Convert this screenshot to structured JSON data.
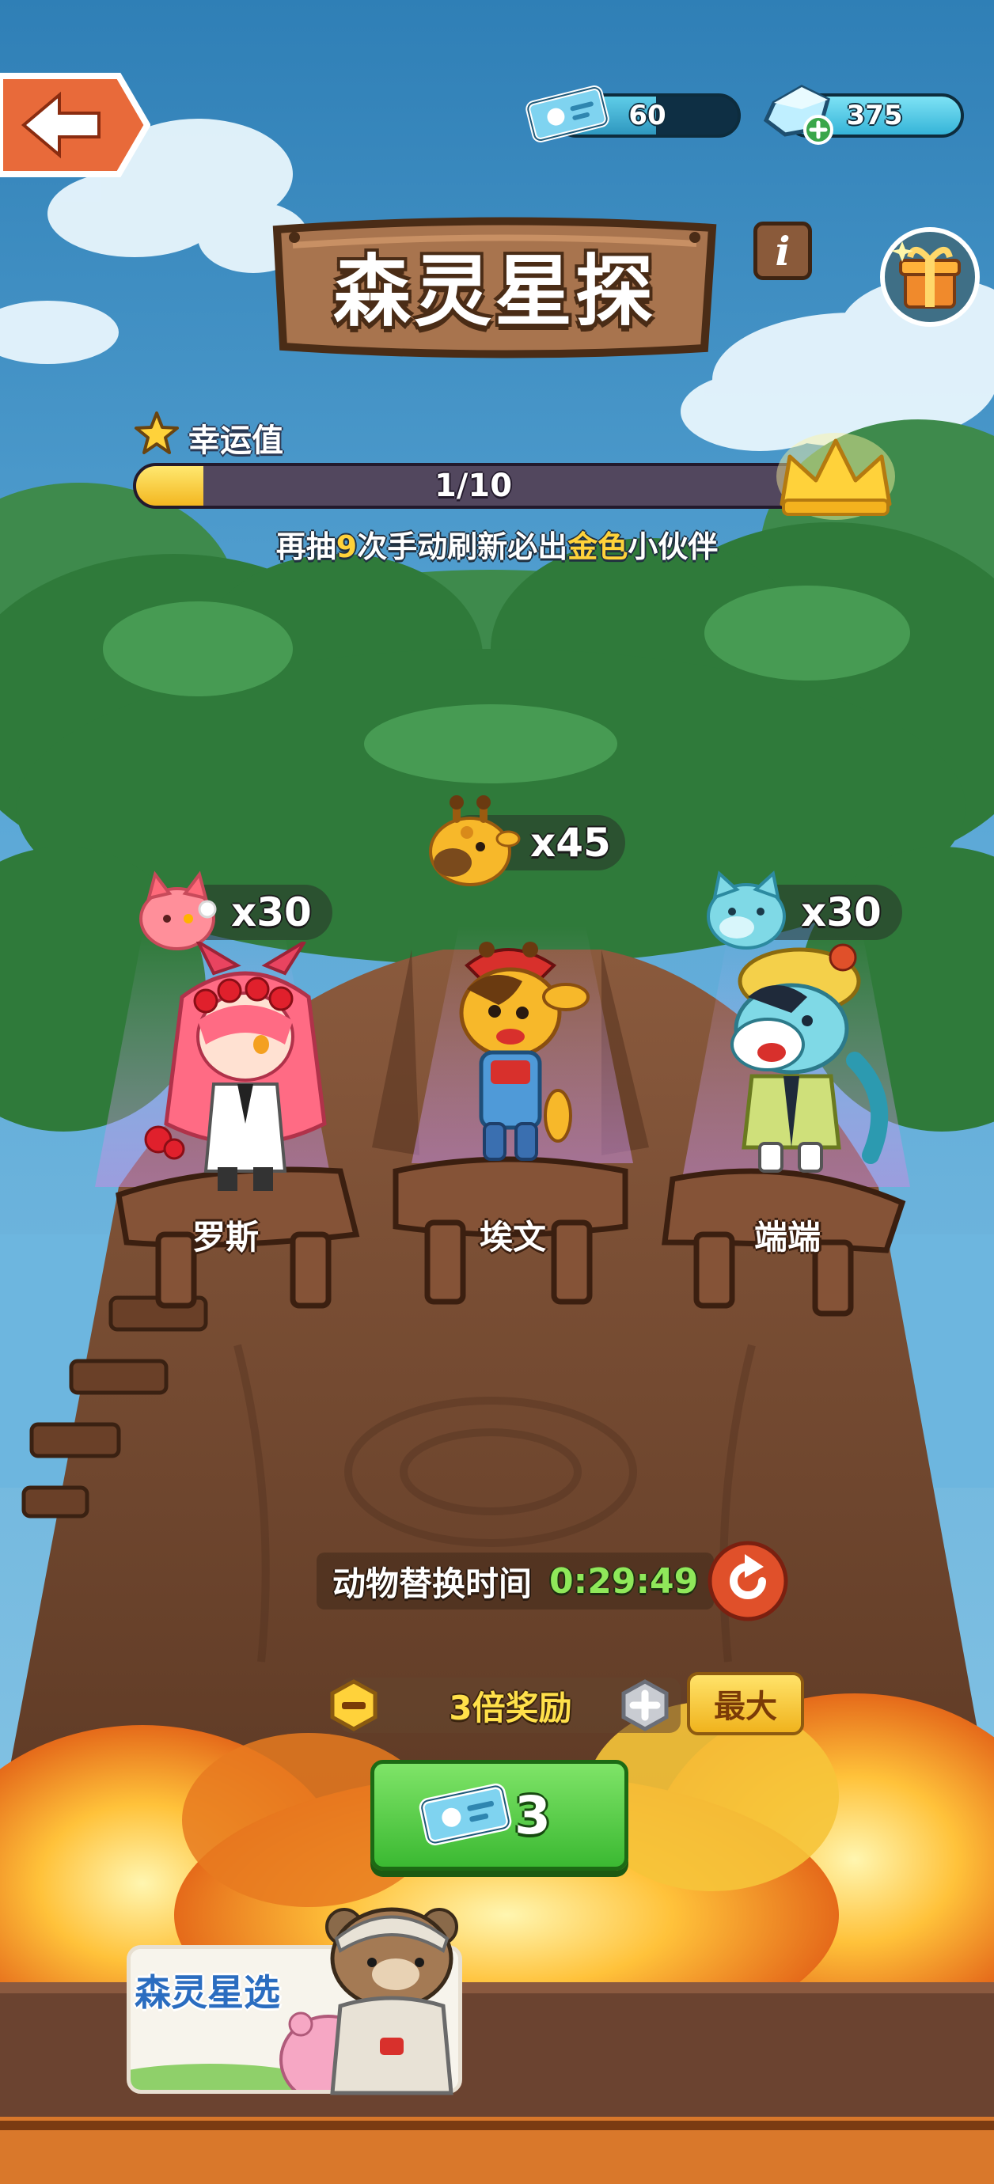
{
  "header": {
    "tickets": {
      "value": "60",
      "fill_fraction": 0.55
    },
    "gems": {
      "value": "375"
    }
  },
  "title": "森灵星探",
  "info_icon_glyph": "i",
  "luck": {
    "label": "幸运值",
    "current": 1,
    "max": 10,
    "count_text": "1/10",
    "hint_prefix": "再抽",
    "hint_number": "9",
    "hint_middle": "次手动刷新必出",
    "hint_highlight": "金色",
    "hint_suffix": "小伙伴"
  },
  "companions": [
    {
      "name": "罗斯",
      "reward": "x30",
      "token": "pink-cat-token"
    },
    {
      "name": "埃文",
      "reward": "x45",
      "token": "giraffe-token"
    },
    {
      "name": "端端",
      "reward": "x30",
      "token": "blue-cat-token"
    }
  ],
  "timer": {
    "label": "动物替换时间",
    "value": "0:29:49"
  },
  "multiplier": {
    "label": "3倍奖励",
    "max_label": "最大"
  },
  "draw": {
    "cost": "3"
  },
  "side_card": {
    "label": "森灵星选"
  },
  "colors": {
    "sky": "#3b8fc4",
    "forest": "#2f7a3a",
    "tree": "#7b4e34",
    "wood": "#8a5a3a",
    "green_button": "#46c23a",
    "gold": "#ffd23a",
    "timer_green": "#8fe85a"
  }
}
